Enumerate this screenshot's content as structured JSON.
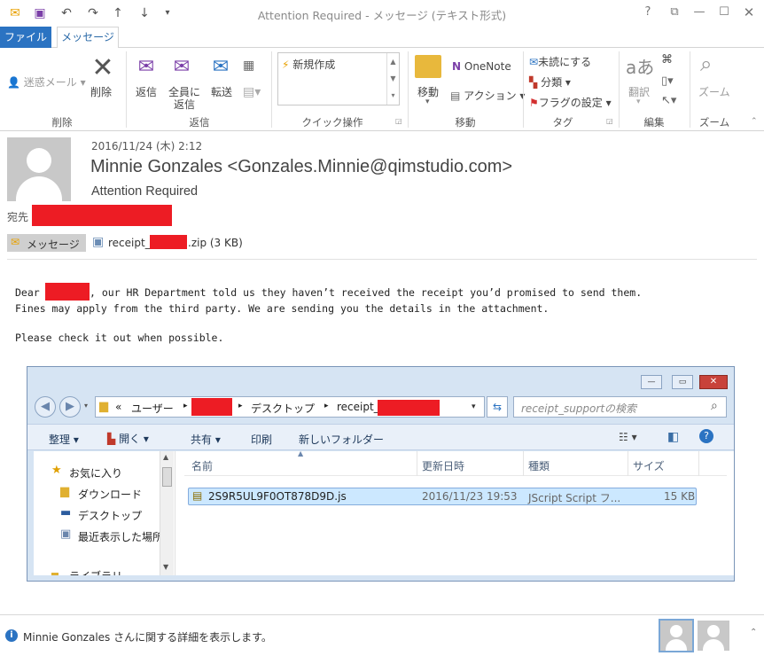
{
  "window": {
    "title": "Attention Required - メッセージ (テキスト形式)"
  },
  "tabs": {
    "file": "ファイル",
    "message": "メッセージ"
  },
  "ribbon": {
    "junk": "迷惑メール",
    "delete": "削除",
    "reply": "返信",
    "reply_all_1": "全員に",
    "reply_all_2": "返信",
    "forward": "転送",
    "quick_new": "新規作成",
    "move": "移動",
    "onenote": "OneNote",
    "actions": "アクション",
    "unread": "未読にする",
    "categorize": "分類",
    "flag": "フラグの設定",
    "translate": "翻訳",
    "zoom": "ズーム",
    "groups": {
      "delete": "削除",
      "respond": "返信",
      "quick_steps": "クイック操作",
      "move": "移動",
      "tags": "タグ",
      "editing": "編集",
      "zoom": "ズーム"
    }
  },
  "message": {
    "date": "2016/11/24 (木) 2:12",
    "sender": "Minnie Gonzales <Gonzales.Minnie@qimstudio.com>",
    "subject": "Attention Required",
    "to_label": "宛先",
    "tab_label": "メッセージ",
    "attachment_prefix": "receipt_",
    "attachment_suffix": ".zip (3 KB)",
    "body_line1_a": "Dear ",
    "body_line1_b": ", our HR Department told us they haven’t received the receipt you’d promised to send them.",
    "body_line2": "Fines may apply from the third party. We are sending you the details in the attachment.",
    "body_line3": "Please check it out when possible."
  },
  "explorer": {
    "path_root": "«",
    "path_users": "ユーザー",
    "path_desktop": "デスクトップ",
    "path_folder": "receipt_",
    "search_placeholder": "receipt_supportの検索",
    "toolbar": {
      "organize": "整理",
      "open": "開く",
      "share": "共有",
      "print": "印刷",
      "new_folder": "新しいフォルダー"
    },
    "nav": {
      "favorites": "お気に入り",
      "downloads": "ダウンロード",
      "desktop": "デスクトップ",
      "recent": "最近表示した場所",
      "library": "ライブラリ"
    },
    "columns": {
      "name": "名前",
      "date": "更新日時",
      "type": "種類",
      "size": "サイズ"
    },
    "file": {
      "name": "2S9R5UL9F0OT878D9D.js",
      "date": "2016/11/23 19:53",
      "type": "JScript Script フ...",
      "size": "15 KB"
    }
  },
  "status": {
    "text": "Minnie Gonzales さんに関する詳細を表示します。"
  }
}
